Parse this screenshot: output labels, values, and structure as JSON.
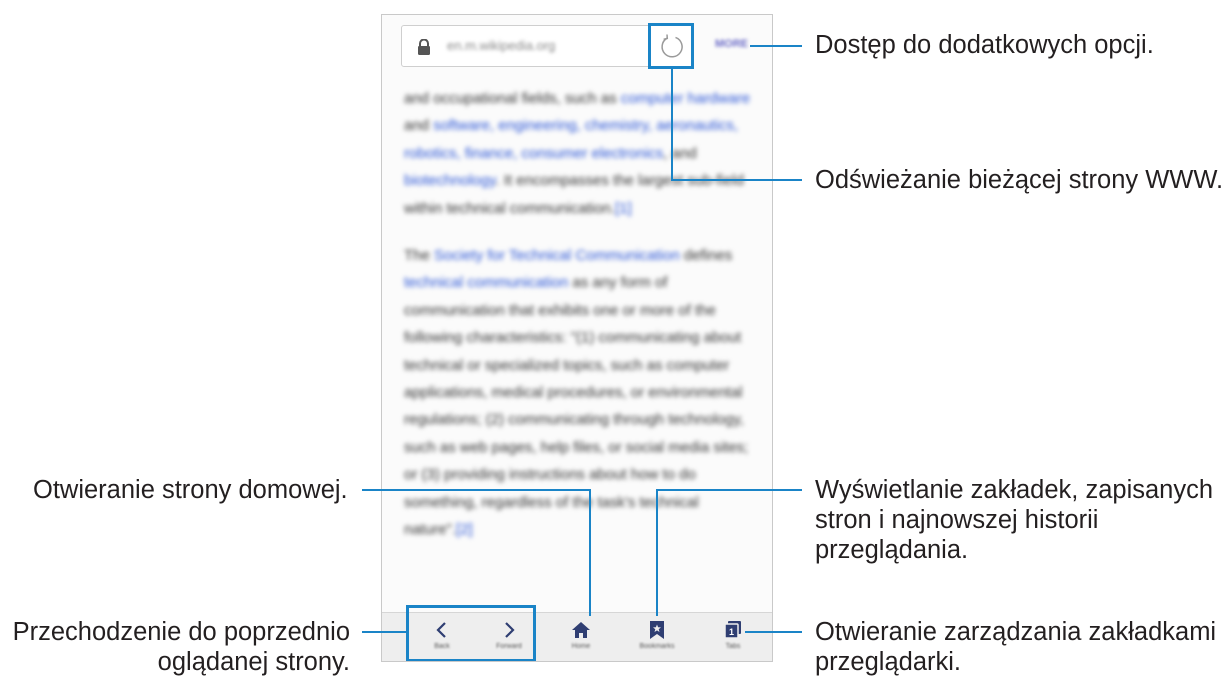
{
  "browser": {
    "url": "en.m.wikipedia.org",
    "more_label": "MORE",
    "article": {
      "p1": [
        {
          "t": "and occupational fields, such as ",
          "link": false
        },
        {
          "t": "computer hardware",
          "link": true
        },
        {
          "t": " and ",
          "link": false
        },
        {
          "t": "software, engineering, chemistry, aeronautics, robotics, finance, consumer electronics",
          "link": true
        },
        {
          "t": ", and ",
          "link": false
        },
        {
          "t": "biotechnology",
          "link": true
        },
        {
          "t": ". It encompasses the largest sub-field within technical communication.",
          "link": false
        },
        {
          "t": "[1]",
          "link": true
        }
      ],
      "p2": [
        {
          "t": "The ",
          "link": false
        },
        {
          "t": "Society for Technical Communication",
          "link": true
        },
        {
          "t": " defines ",
          "link": false
        },
        {
          "t": "technical communication",
          "link": true
        },
        {
          "t": " as any form of communication that exhibits one or more of the following characteristics: \"(1) communicating about technical or specialized topics, such as computer applications, medical procedures, or environmental regulations; (2) communicating through technology, such as web pages, help files, or social media sites; or (3) providing instructions about how to do something, regardless of the task's technical nature\".",
          "link": false
        },
        {
          "t": "[2]",
          "link": true
        }
      ]
    },
    "toolbar": {
      "back": "Back",
      "forward": "Forward",
      "home": "Home",
      "bookmarks": "Bookmarks",
      "tabs": "Tabs"
    }
  },
  "callouts": {
    "more_options": "Dostęp do dodatkowych opcji.",
    "refresh": "Odświeżanie bieżącej strony WWW.",
    "home": "Otwieranie strony domowej.",
    "bookmarks_line1": "Wyświetlanie zakładek, zapisanych",
    "bookmarks_line2": "stron i najnowszej historii",
    "bookmarks_line3": "przeglądania.",
    "back_forward_line1": "Przechodzenie do poprzednio",
    "back_forward_line2": "oglądanej strony.",
    "tabs_line1": "Otwieranie zarządzania zakładkami",
    "tabs_line2": "przeglądarki."
  },
  "colors": {
    "accent": "#1a84c7",
    "icon": "#2f3e72",
    "link": "#2a55d6"
  }
}
